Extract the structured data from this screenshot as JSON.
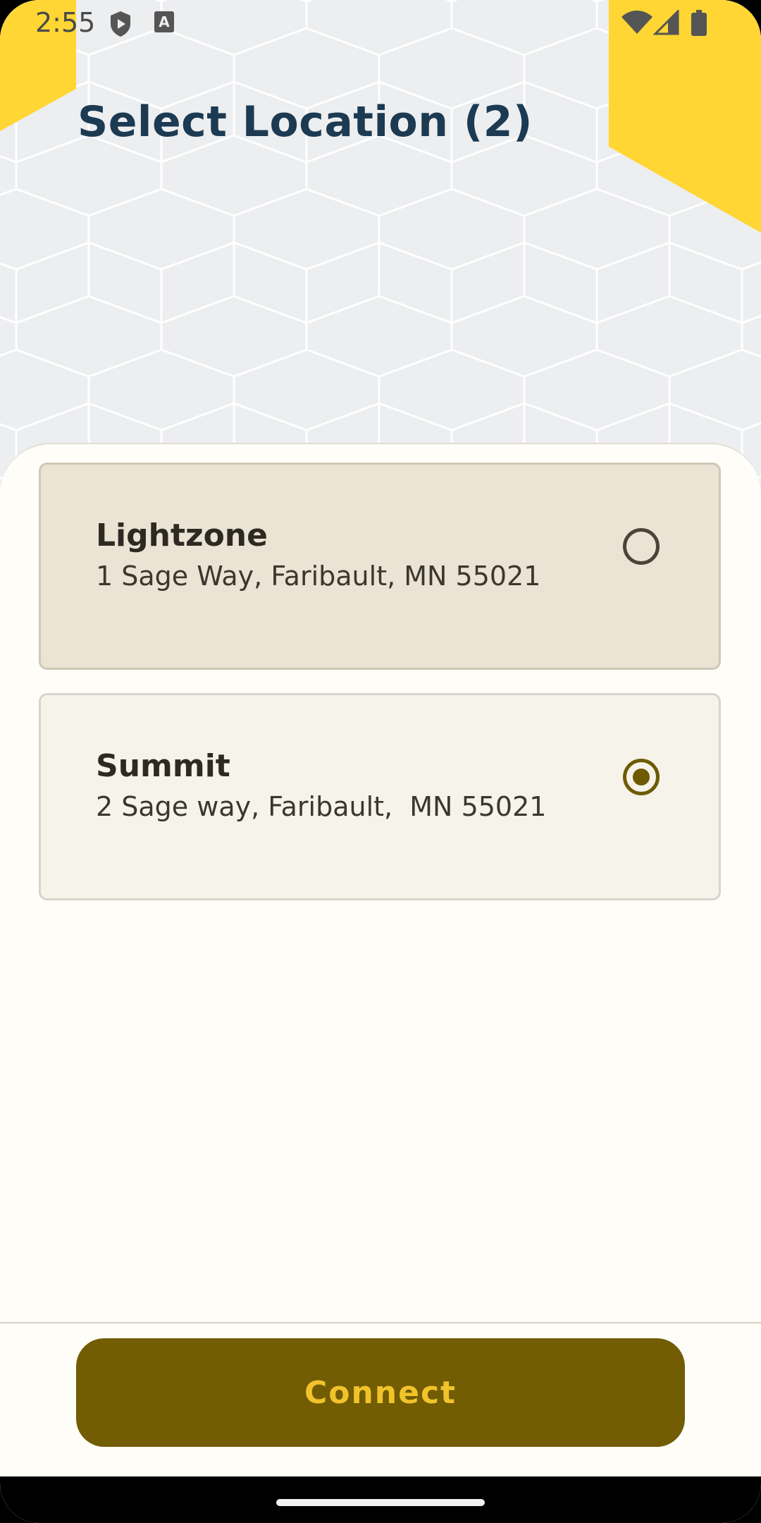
{
  "status_bar": {
    "time": "2:55",
    "icons_left": [
      "shield-play-icon",
      "text-a-icon"
    ],
    "icons_right": [
      "wifi-icon",
      "cell-signal-icon",
      "battery-icon"
    ]
  },
  "header": {
    "title": "Select Location (2)"
  },
  "locations": [
    {
      "name": "Lightzone",
      "address": "1 Sage Way, Faribault, MN 55021",
      "selected": false
    },
    {
      "name": "Summit",
      "address": "2 Sage way, Faribault,  MN 55021",
      "selected": true
    }
  ],
  "footer": {
    "connect_label": "Connect"
  },
  "colors": {
    "accent_yellow": "#ffd633",
    "title_navy": "#1c3a52",
    "button_olive": "#725c04",
    "button_text": "#f0c32a",
    "selected_card": "#ebe3d4"
  }
}
